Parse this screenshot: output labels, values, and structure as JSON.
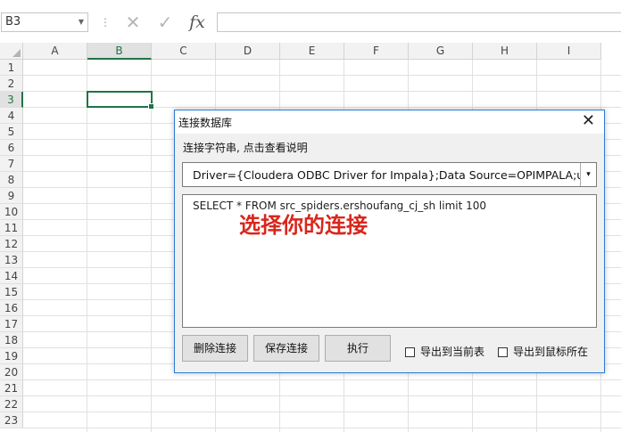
{
  "formula_bar": {
    "name_box": "B3",
    "separator": "⋮",
    "cancel_glyph": "✕",
    "enter_glyph": "✓",
    "fx_label": "fx",
    "formula": ""
  },
  "sheet": {
    "columns": [
      "A",
      "B",
      "C",
      "D",
      "E",
      "F",
      "G",
      "H",
      "I"
    ],
    "rows": [
      "1",
      "2",
      "3",
      "4",
      "5",
      "6",
      "7",
      "8",
      "9",
      "10",
      "11",
      "12",
      "13",
      "14",
      "15",
      "16",
      "17",
      "18",
      "19",
      "20",
      "21",
      "22",
      "23"
    ],
    "selected_column": "B",
    "selected_row": "3"
  },
  "dialog": {
    "title": "连接数据库",
    "close_glyph": "✕",
    "connection_label": "连接字符串, 点击查看说明",
    "connection_string": "Driver={Cloudera ODBC Driver for Impala};Data Source=OPIMPALA;user id",
    "combo_arrow": "▾",
    "sql": "SELECT *  FROM src_spiders.ershoufang_cj_sh limit 100",
    "overlay_text": "选择你的连接",
    "buttons": {
      "delete": "删除连接",
      "save": "保存连接",
      "execute": "执行"
    },
    "checkboxes": {
      "export_current": "导出到当前表",
      "export_cursor": "导出到鼠标所在"
    }
  },
  "colors": {
    "excel_green": "#217346",
    "dialog_border": "#2b7bd4",
    "overlay_red": "#d9261c"
  }
}
